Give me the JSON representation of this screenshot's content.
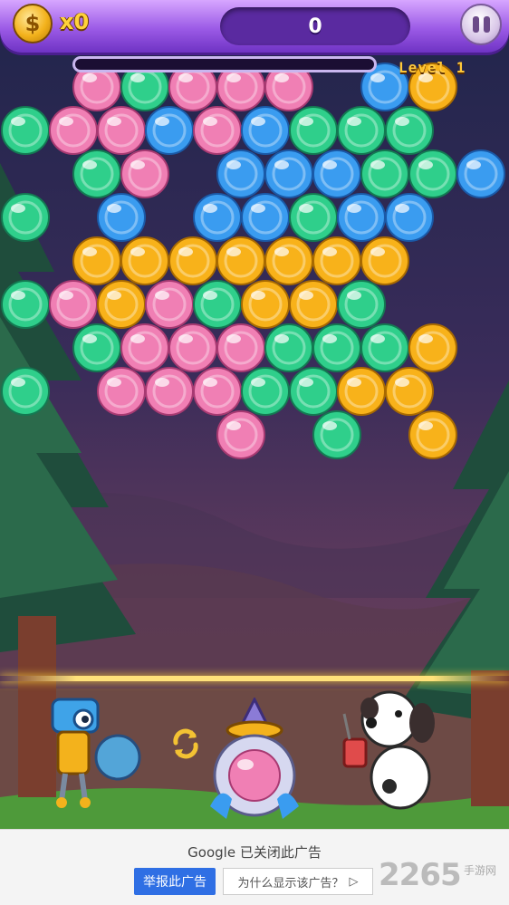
{
  "hud": {
    "coin_symbol": "$",
    "coin_count": "x0",
    "score": "0",
    "level_label": "Level 1",
    "progress_fraction": 0
  },
  "colors": {
    "pink": "#f07fb4",
    "green": "#2fcf8b",
    "blue": "#3a9cf0",
    "yellow": "#f8b21a"
  },
  "board": {
    "rows": [
      "-PGPPP-BY--",
      "GPPBPBGGG-",
      "-GP-BBBGGBB",
      "G-B-BBGBB-",
      "-YYYYYYY---",
      "GPYPGYYG--",
      "-GPPPGGGY--",
      "G-PPPGGYY-",
      "----P-G-Y--"
    ],
    "next_bubble": "P"
  },
  "icons": {
    "pause": "pause-icon",
    "swap": "swap-arrows-icon",
    "coin": "coin-icon"
  },
  "ad": {
    "title": "Google 已关闭此广告",
    "report_label": "举报此广告",
    "why_label": "为什么显示该广告？",
    "why_icon": "▷"
  },
  "watermark": {
    "main": "2265",
    "sub": "手游网"
  }
}
